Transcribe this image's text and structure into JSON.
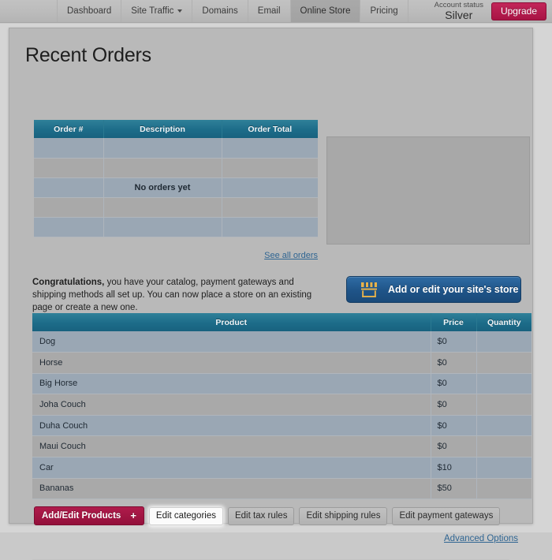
{
  "nav": {
    "items": [
      {
        "label": "Dashboard",
        "active": false,
        "caret": false
      },
      {
        "label": "Site Traffic",
        "active": false,
        "caret": true
      },
      {
        "label": "Domains",
        "active": false,
        "caret": false
      },
      {
        "label": "Email",
        "active": false,
        "caret": false
      },
      {
        "label": "Online Store",
        "active": true,
        "caret": false
      },
      {
        "label": "Pricing",
        "active": false,
        "caret": false
      }
    ],
    "account_status_label": "Account status",
    "account_tier": "Silver",
    "upgrade_label": "Upgrade"
  },
  "page": {
    "title": "Recent Orders"
  },
  "orders": {
    "headers": [
      "Order #",
      "Description",
      "Order Total"
    ],
    "empty_message": "No orders yet",
    "empty_row_count": 5,
    "empty_message_row_index": 2,
    "see_all_link": "See all orders"
  },
  "congratulations": {
    "lead": "Congratulations,",
    "body": " you have your catalog, payment gateways and shipping methods all set up. You can now place a store on an existing page or create a new one."
  },
  "store_button": {
    "label": "Add or edit your site's store",
    "icon": "storefront-icon",
    "icon_color": "#e8b24a"
  },
  "products": {
    "headers": [
      "Product",
      "Price",
      "Quantity"
    ],
    "rows": [
      {
        "product": "Dog",
        "price": "$0",
        "quantity": ""
      },
      {
        "product": "Horse",
        "price": "$0",
        "quantity": ""
      },
      {
        "product": "Big Horse",
        "price": "$0",
        "quantity": ""
      },
      {
        "product": "Joha Couch",
        "price": "$0",
        "quantity": ""
      },
      {
        "product": "Duha Couch",
        "price": "$0",
        "quantity": ""
      },
      {
        "product": "Maui Couch",
        "price": "$0",
        "quantity": ""
      },
      {
        "product": "Car",
        "price": "$10",
        "quantity": ""
      },
      {
        "product": "Bananas",
        "price": "$50",
        "quantity": ""
      }
    ]
  },
  "actions": {
    "buttons": [
      {
        "label": "Add/Edit Products",
        "style": "primary",
        "plus": "+"
      },
      {
        "label": "Edit categories",
        "style": "focused"
      },
      {
        "label": "Edit tax rules",
        "style": "default"
      },
      {
        "label": "Edit shipping rules",
        "style": "default"
      },
      {
        "label": "Edit payment gateways",
        "style": "default"
      }
    ],
    "advanced_options_link": "Advanced Options"
  },
  "colors": {
    "table_header": "#1d6c89",
    "link": "#2f6592",
    "primary_button": "#a81444",
    "store_button": "#1f5488"
  }
}
